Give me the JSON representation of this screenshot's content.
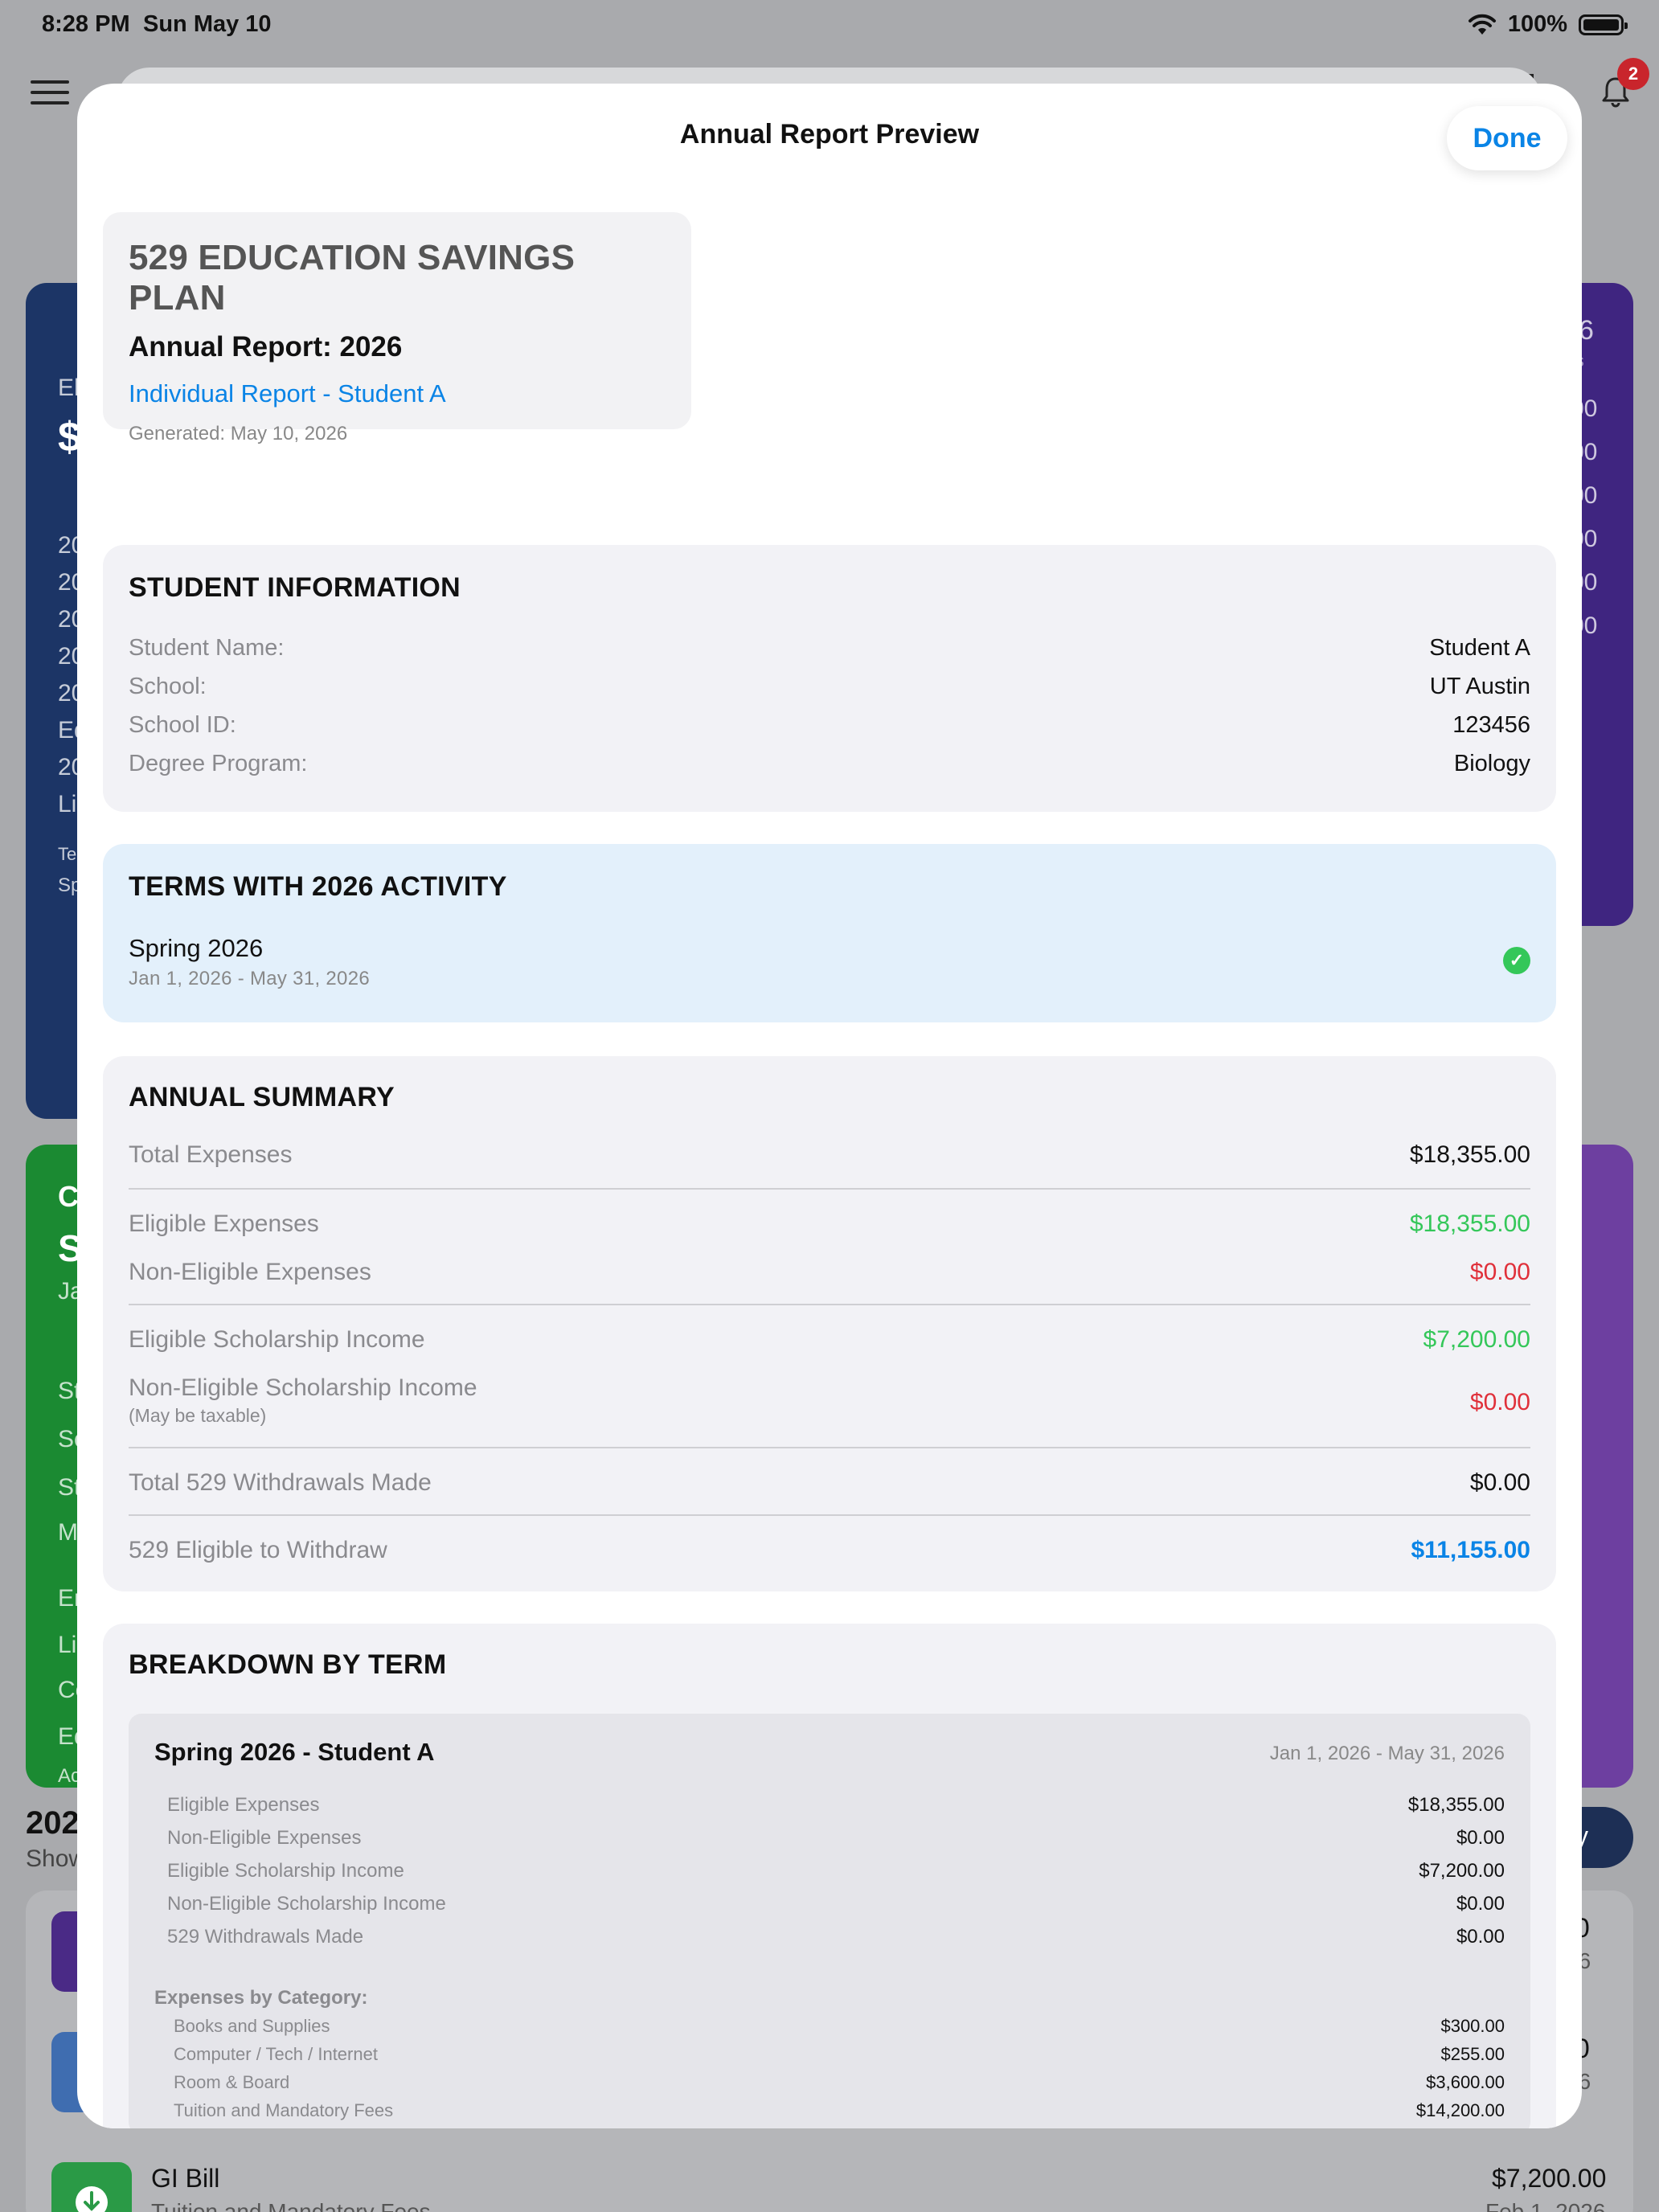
{
  "status_bar": {
    "time": "8:28 PM",
    "date": "Sun May 10",
    "battery": "100%"
  },
  "background": {
    "notification_count": "2",
    "year_heading": "202",
    "show_label": "Show",
    "list": [
      {
        "title": "GI Bill",
        "subtitle": "Tuition and Mandatory Fees",
        "amount": "$7,200.00",
        "date": "Feb 1, 2026"
      }
    ],
    "fragments": {
      "blue_card": [
        "El",
        "$",
        "20",
        "20",
        "20",
        "20",
        "20",
        "Ed",
        "20",
        "Li",
        "Te",
        "Sp"
      ],
      "green_card": [
        "C",
        "S",
        "Ja",
        "St",
        "Sc",
        "St",
        "M",
        "En",
        "Li",
        "Co",
        "Ed",
        "Ac"
      ],
      "purple_card": [
        "6",
        "ils",
        "00",
        "00",
        "00",
        "00",
        "00",
        "00"
      ],
      "list_right": [
        "00",
        "26",
        "00",
        "26"
      ],
      "pill": "y"
    }
  },
  "sheet": {
    "title": "Annual Report Preview",
    "done_label": "Done"
  },
  "report_header": {
    "plan_name": "529 EDUCATION SAVINGS PLAN",
    "report_year": "Annual Report: 2026",
    "report_type": "Individual Report - Student A",
    "generated": "Generated: May 10, 2026"
  },
  "student_info": {
    "title": "STUDENT INFORMATION",
    "rows": [
      {
        "label": "Student Name:",
        "value": "Student A"
      },
      {
        "label": "School:",
        "value": "UT Austin"
      },
      {
        "label": "School ID:",
        "value": "123456"
      },
      {
        "label": "Degree Program:",
        "value": "Biology"
      }
    ]
  },
  "terms": {
    "title": "TERMS WITH 2026 ACTIVITY",
    "items": [
      {
        "name": "Spring 2026",
        "dates": "Jan 1, 2026 - May 31, 2026",
        "status_icon": "check-circle-icon"
      }
    ]
  },
  "annual_summary": {
    "title": "ANNUAL SUMMARY",
    "total_expenses": {
      "label": "Total Expenses",
      "value": "$18,355.00"
    },
    "eligible_expenses": {
      "label": "Eligible Expenses",
      "value": "$18,355.00"
    },
    "non_eligible_expenses": {
      "label": "Non-Eligible Expenses",
      "value": "$0.00"
    },
    "eligible_scholarship": {
      "label": "Eligible Scholarship Income",
      "value": "$7,200.00"
    },
    "non_eligible_scholarship": {
      "label": "Non-Eligible Scholarship Income",
      "note": "(May be taxable)",
      "value": "$0.00"
    },
    "withdrawals_made": {
      "label": "Total 529 Withdrawals Made",
      "value": "$0.00"
    },
    "eligible_to_withdraw": {
      "label": "529 Eligible to Withdraw",
      "value": "$11,155.00"
    }
  },
  "breakdown": {
    "title": "BREAKDOWN BY TERM",
    "term": {
      "title": "Spring 2026 - Student A",
      "dates": "Jan 1, 2026 - May 31, 2026",
      "rows": [
        {
          "label": "Eligible Expenses",
          "value": "$18,355.00"
        },
        {
          "label": "Non-Eligible Expenses",
          "value": "$0.00"
        },
        {
          "label": "Eligible Scholarship Income",
          "value": "$7,200.00"
        },
        {
          "label": "Non-Eligible Scholarship Income",
          "value": "$0.00"
        },
        {
          "label": "529 Withdrawals Made",
          "value": "$0.00"
        }
      ],
      "categories_title": "Expenses by Category:",
      "categories": [
        {
          "label": "Books and Supplies",
          "value": "$300.00"
        },
        {
          "label": "Computer / Tech / Internet",
          "value": "$255.00"
        },
        {
          "label": "Room & Board",
          "value": "$3,600.00"
        },
        {
          "label": "Tuition and Mandatory Fees",
          "value": "$14,200.00"
        }
      ]
    }
  },
  "colors": {
    "accent_blue": "#0a84e6",
    "positive_green": "#34c759",
    "negative_red": "#e0303a",
    "terms_highlight": "#e3f0fb"
  }
}
